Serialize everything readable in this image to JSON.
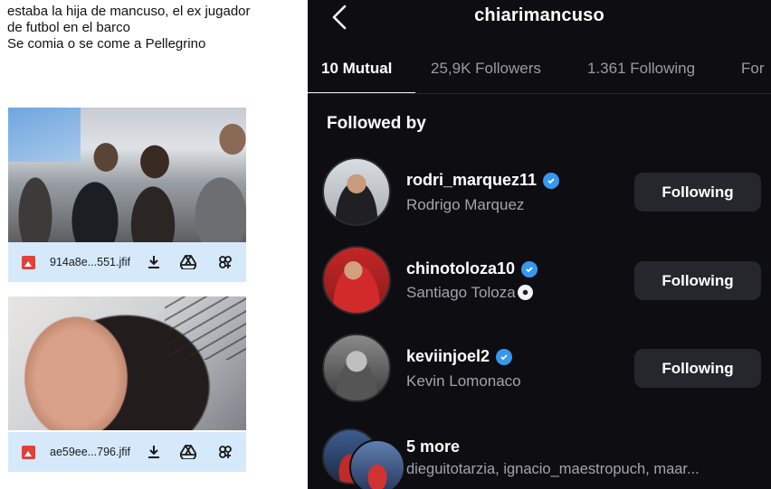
{
  "left_post": {
    "lines": [
      "estaba la hija de mancuso, el ex jugador",
      "de futbol en el barco",
      "Se comia o se come a Pellegrino"
    ],
    "attachments": [
      {
        "file_name": "914a8e...551.jfif"
      },
      {
        "file_name": "ae59ee...796.jfif"
      }
    ],
    "icons": [
      "image-file-icon",
      "download-icon",
      "drive-icon",
      "share-icon"
    ]
  },
  "profile": {
    "username": "chiarimancuso",
    "tabs": [
      {
        "label": "10 Mutual",
        "active": true
      },
      {
        "label": "25,9K Followers",
        "active": false
      },
      {
        "label": "1.361 Following",
        "active": false
      },
      {
        "label": "For",
        "active": false
      }
    ],
    "section_title": "Followed by",
    "followers": [
      {
        "handle": "rodri_marquez11",
        "name": "Rodrigo Marquez",
        "verified": true,
        "button": "Following"
      },
      {
        "handle": "chinotoloza10",
        "name": "Santiago Toloza",
        "verified": true,
        "button": "Following"
      },
      {
        "handle": "keviinjoel2",
        "name": "Kevin Lomonaco",
        "verified": true,
        "button": "Following"
      }
    ],
    "more": {
      "title": "5 more",
      "names": "dieguitotarzia, ignacio_maestropuch, maar..."
    },
    "colors": {
      "background": "#0e0e12",
      "verified": "#3897f0",
      "button": "#26272c",
      "secondary_text": "#a3a4aa"
    }
  }
}
